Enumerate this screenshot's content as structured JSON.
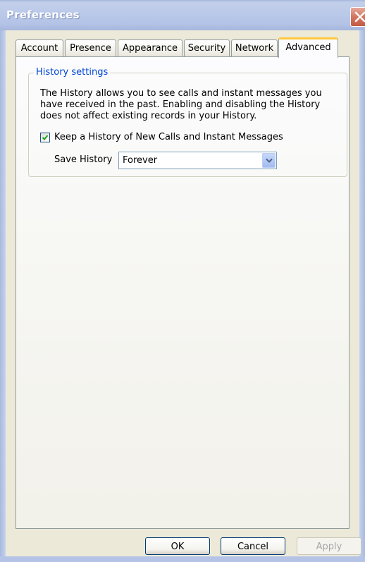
{
  "window": {
    "title": "Preferences"
  },
  "tabs": [
    {
      "label": "Account"
    },
    {
      "label": "Presence"
    },
    {
      "label": "Appearance"
    },
    {
      "label": "Security"
    },
    {
      "label": "Network"
    },
    {
      "label": "Advanced",
      "selected": true
    }
  ],
  "history": {
    "group_title": "History settings",
    "description": "The History allows you to see calls and instant messages you have received in the past.  Enabling and disabling the History does not affect existing records in your History.",
    "keep_history_label": "Keep a History of New Calls and Instant Messages",
    "keep_history_checked": true,
    "save_history_label": "Save History",
    "save_history_value": "Forever"
  },
  "buttons": {
    "ok": "OK",
    "cancel": "Cancel",
    "apply": "Apply"
  },
  "colors": {
    "group_title": "#0046d5",
    "active_tab_accent": "#ffc83c",
    "close_button": "#c55a43"
  }
}
